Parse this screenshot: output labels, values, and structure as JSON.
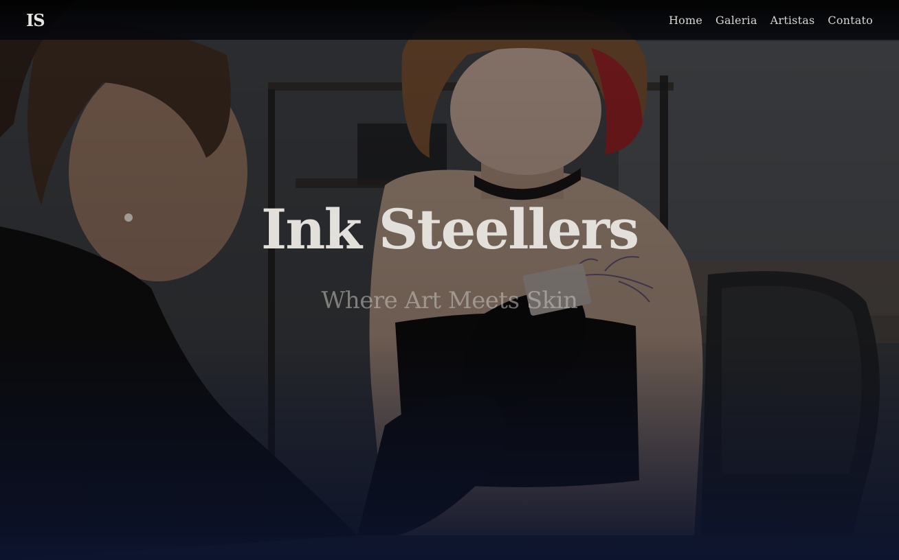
{
  "nav": {
    "logo": "IS",
    "links": [
      "Home",
      "Galeria",
      "Artistas",
      "Contato"
    ]
  },
  "hero": {
    "title": "Ink Steellers",
    "subtitle": "Where Art Meets Skin",
    "background_image": "tattoo-artist-working-photo"
  },
  "colors": {
    "overlay_bottom": "#0c142e",
    "text_primary": "#e3e0dc",
    "nav_bg": "#000000"
  }
}
